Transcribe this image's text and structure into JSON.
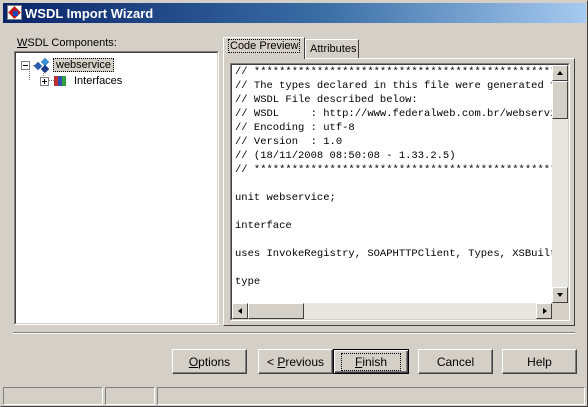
{
  "window": {
    "title": "WSDL Import Wizard"
  },
  "components_panel": {
    "label_accel": "W",
    "label_rest": "SDL Components:",
    "tree": [
      {
        "label": "webservice",
        "expanded": true,
        "selected": true,
        "icon": "webservice-icon"
      },
      {
        "label": "Interfaces",
        "expanded": false,
        "selected": false,
        "icon": "books-icon"
      }
    ]
  },
  "tabs": [
    {
      "label": "Code Preview",
      "active": true
    },
    {
      "label": "Attributes",
      "active": false
    }
  ],
  "code_preview": {
    "lines": [
      "// ************************************************************************",
      "// The types declared in this file were generated from data read from the",
      "// WSDL File described below:",
      "// WSDL     : http://www.federalweb.com.br/webservice/webservice.wsdl",
      "// Encoding : utf-8",
      "// Version  : 1.0",
      "// (18/11/2008 08:50:08 - 1.33.2.5)",
      "// ************************************************************************",
      "",
      "unit webservice;",
      "",
      "interface",
      "",
      "uses InvokeRegistry, SOAPHTTPClient, Types, XSBuiltIns;",
      "",
      "type"
    ]
  },
  "buttons": {
    "options": {
      "accel": "O",
      "rest": "ptions"
    },
    "previous": {
      "prefix": "< ",
      "accel": "P",
      "rest": "revious"
    },
    "finish": {
      "accel": "F",
      "rest": "inish"
    },
    "cancel": {
      "label": "Cancel"
    },
    "help": {
      "label": "Help"
    }
  },
  "statusbar": {
    "panes": [
      "",
      "",
      ""
    ]
  }
}
